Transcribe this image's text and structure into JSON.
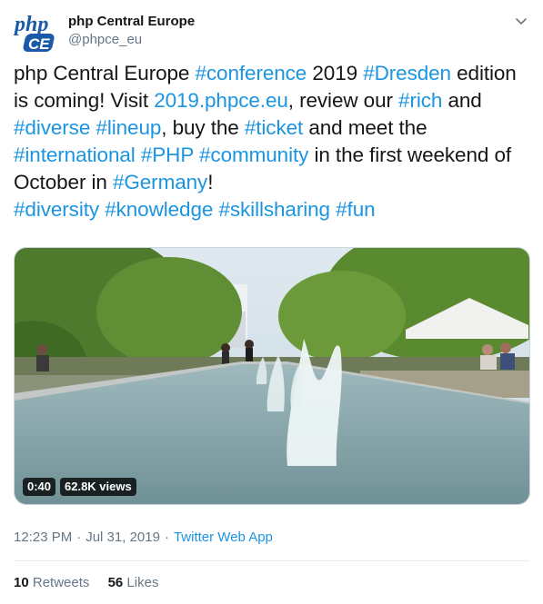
{
  "author": {
    "logo_text_top": "php",
    "logo_text_bottom": "CE",
    "name": "php Central Europe",
    "handle": "@phpce_eu"
  },
  "tweet": {
    "lines": [
      [
        {
          "text": "php Central Europe ",
          "link": false
        },
        {
          "text": "#conference",
          "link": true
        },
        {
          "text": " 2019 ",
          "link": false
        },
        {
          "text": "#Dresden",
          "link": true
        },
        {
          "text": " edition",
          "link": false
        }
      ],
      [
        {
          "text": "is coming! Visit ",
          "link": false
        },
        {
          "text": "2019.phpce.eu",
          "link": true
        },
        {
          "text": ", review our ",
          "link": false
        },
        {
          "text": "#rich",
          "link": true
        },
        {
          "text": " and",
          "link": false
        }
      ],
      [
        {
          "text": "#diverse",
          "link": true
        },
        {
          "text": " ",
          "link": false
        },
        {
          "text": "#lineup",
          "link": true
        },
        {
          "text": ", buy the ",
          "link": false
        },
        {
          "text": "#ticket",
          "link": true
        },
        {
          "text": " and meet the",
          "link": false
        }
      ],
      [
        {
          "text": "#international",
          "link": true
        },
        {
          "text": " ",
          "link": false
        },
        {
          "text": "#PHP",
          "link": true
        },
        {
          "text": " ",
          "link": false
        },
        {
          "text": "#community",
          "link": true
        },
        {
          "text": " in the first weekend of",
          "link": false
        }
      ],
      [
        {
          "text": "October in ",
          "link": false
        },
        {
          "text": "#Germany",
          "link": true
        },
        {
          "text": "!",
          "link": false
        }
      ],
      [
        {
          "text": "#diversity",
          "link": true
        },
        {
          "text": " ",
          "link": false
        },
        {
          "text": "#knowledge",
          "link": true
        },
        {
          "text": " ",
          "link": false
        },
        {
          "text": "#skillsharing",
          "link": true
        },
        {
          "text": " ",
          "link": false
        },
        {
          "text": "#fun",
          "link": true
        }
      ]
    ]
  },
  "media": {
    "duration": "0:40",
    "views": "62.8K views"
  },
  "meta": {
    "time": "12:23 PM",
    "separator": "·",
    "date": "Jul 31, 2019",
    "source": "Twitter Web App"
  },
  "stats": {
    "retweets_count": "10",
    "retweets_label": "Retweets",
    "likes_count": "56",
    "likes_label": "Likes"
  },
  "colors": {
    "link": "#1b95e0",
    "text": "#14171a",
    "secondary": "#657786",
    "logo_blue": "#1a5aa8"
  }
}
